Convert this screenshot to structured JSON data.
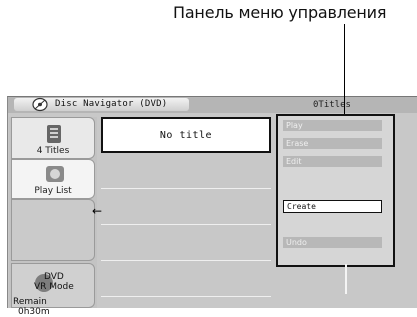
{
  "callout_label": "Панель меню управления",
  "window": {
    "title": "Disc Navigator (DVD)",
    "titles_count": "0Titles"
  },
  "sidebar": {
    "items": [
      {
        "label": "4 Titles",
        "icon": "title-list-icon"
      },
      {
        "label": "Play List",
        "icon": "playlist-icon"
      }
    ],
    "mode": {
      "line1": "DVD",
      "line2": "VR Mode"
    },
    "remain": {
      "line1": "Remain",
      "line2": "0h30m"
    }
  },
  "content": {
    "first_row": "No title"
  },
  "menu": {
    "items": [
      {
        "label": "Play",
        "enabled": false
      },
      {
        "label": "Erase",
        "enabled": false
      },
      {
        "label": "Edit",
        "enabled": false
      },
      {
        "label": "Create",
        "enabled": true
      },
      {
        "label": "Undo",
        "enabled": false
      }
    ]
  },
  "arrow_glyph": "←",
  "colors": {
    "background": "#c8c8c8",
    "panel": "#d6d6d6",
    "highlight": "#ffffff"
  }
}
